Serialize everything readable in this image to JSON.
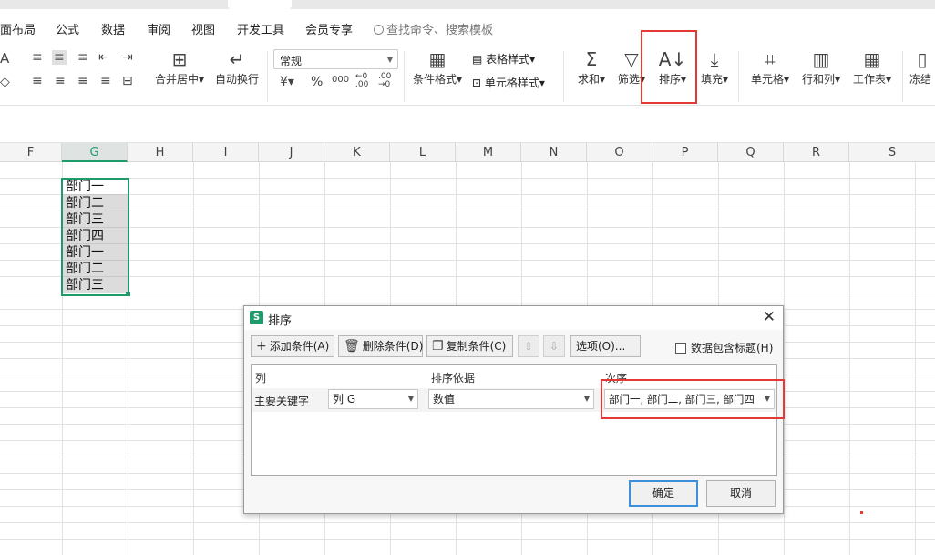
{
  "menubar": {
    "items": [
      "面布局",
      "公式",
      "数据",
      "审阅",
      "视图",
      "开发工具",
      "会员专享"
    ],
    "search_placeholder": "查找命令、搜索模板"
  },
  "ribbon": {
    "merge_center": "合并居中",
    "auto_wrap": "自动换行",
    "number_format": "常规",
    "currency_symbol": "¥",
    "percent_symbol": "%",
    "thousands_symbol": "000",
    "dec_inc": "←0 .00",
    "dec_dec": ".00 →0",
    "conditional_format": "条件格式",
    "table_style": "表格样式",
    "cell_style": "单元格样式",
    "sum": "求和",
    "filter": "筛选",
    "sort": "排序",
    "fill": "填充",
    "cells": "单元格",
    "rows_cols": "行和列",
    "worksheet": "工作表",
    "freeze": "冻结",
    "highlight_color": "#e53935"
  },
  "sheet": {
    "columns": [
      "F",
      "G",
      "H",
      "I",
      "J",
      "K",
      "L",
      "M",
      "N",
      "O",
      "P",
      "Q",
      "R",
      "S"
    ],
    "active_column": "G",
    "g_values": [
      "部门一",
      "部门二",
      "部门三",
      "部门四",
      "部门一",
      "部门二",
      "部门三"
    ],
    "selection_color": "#1e9a6b"
  },
  "dialog": {
    "title": "排序",
    "app_icon": "S",
    "buttons": {
      "add": "添加条件(A)",
      "delete": "删除条件(D)",
      "copy": "复制条件(C)",
      "options": "选项(O)...",
      "ok": "确定",
      "cancel": "取消"
    },
    "header_checkbox": "数据包含标题(H)",
    "header_checkbox_checked": false,
    "columns": {
      "col": "列",
      "basis": "排序依据",
      "order": "次序"
    },
    "row": {
      "label": "主要关键字",
      "column": "列 G",
      "basis": "数值",
      "order": "部门一, 部门二, 部门三, 部门四"
    }
  }
}
